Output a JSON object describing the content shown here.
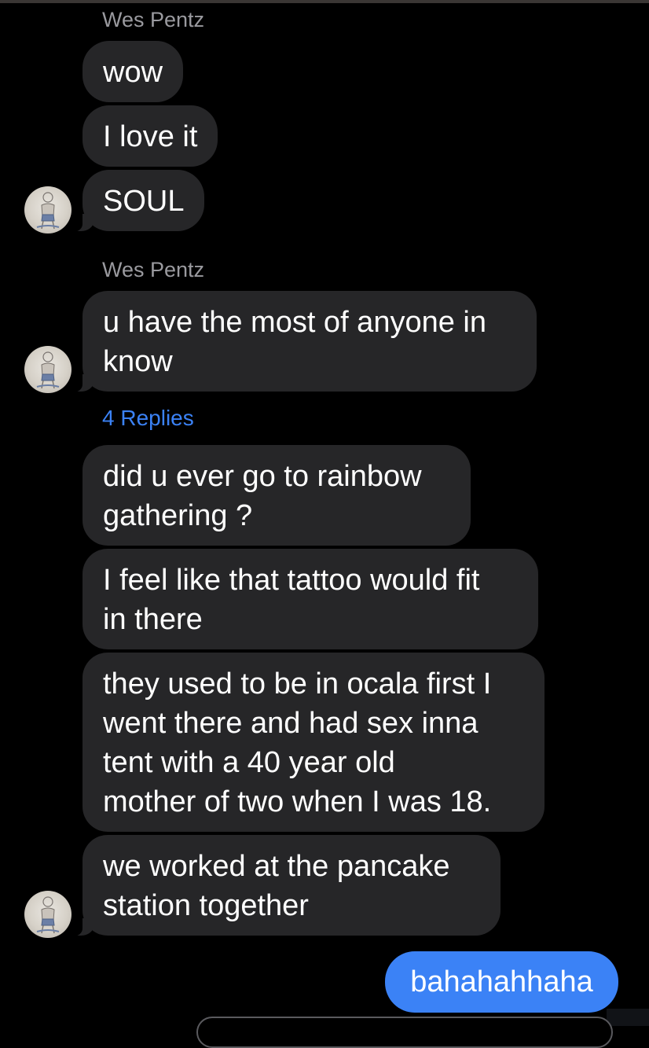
{
  "conversation": {
    "sender_name": "Wes Pentz",
    "replies_label": "4 Replies",
    "groups": [
      {
        "sender": "Wes Pentz",
        "messages": [
          "wow",
          "I love it",
          "SOUL"
        ]
      },
      {
        "sender": "Wes Pentz",
        "messages": [
          "u have the most of anyone in",
          "know"
        ]
      }
    ],
    "thread_messages": [
      [
        "did u ever go to rainbow",
        "gathering ?"
      ],
      [
        "I feel like that tattoo would fit",
        "in there"
      ],
      [
        "they used to be in ocala first I",
        "went there and had sex inna",
        "tent with a 40 year old",
        "mother of two when I was 18."
      ],
      [
        "we worked at the pancake",
        "station together"
      ]
    ],
    "my_message": "bahahahhaha"
  },
  "colors": {
    "background": "#000000",
    "incoming_bubble": "#262628",
    "outgoing_bubble": "#3b82f6",
    "sender_text": "#9a9a9f",
    "link_text": "#3b82f6"
  },
  "icons": {
    "avatar": "user-avatar-sketch"
  }
}
